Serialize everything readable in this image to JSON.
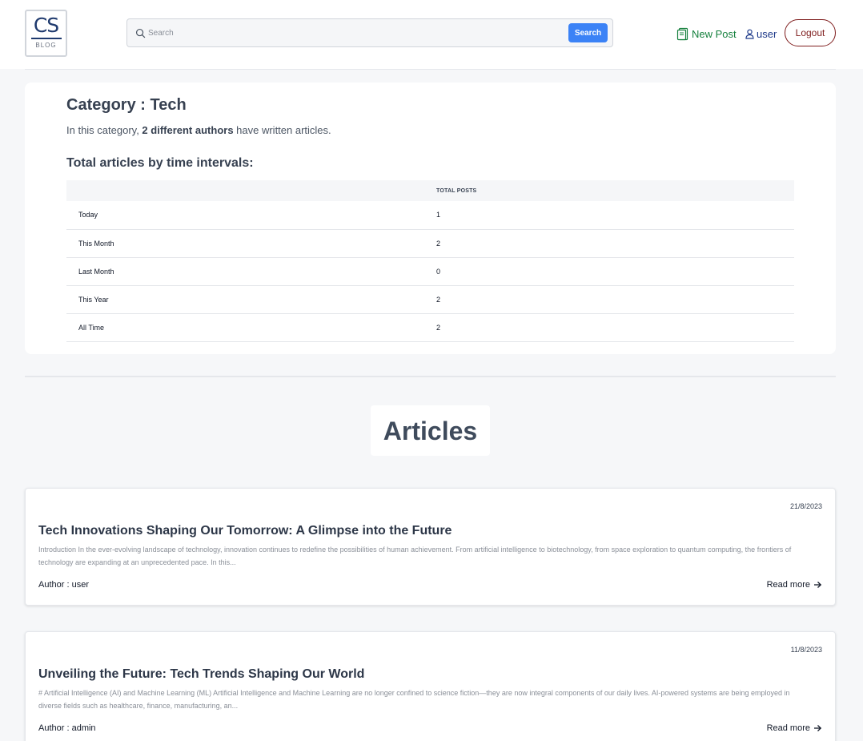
{
  "header": {
    "logo_text": "CS",
    "logo_subtext": "BLOG",
    "search_placeholder": "Search",
    "search_button": "Search",
    "new_post": "New Post",
    "user": "user",
    "logout": "Logout"
  },
  "category": {
    "title": "Category : Tech",
    "desc_prefix": "In this category, ",
    "desc_bold": "2 different authors",
    "desc_suffix": " have written articles.",
    "intervals_title": "Total articles by time intervals:",
    "table_header": [
      "",
      "TOTAL POSTS"
    ],
    "rows": [
      {
        "label": "Today",
        "value": "1"
      },
      {
        "label": "This Month",
        "value": "2"
      },
      {
        "label": "Last Month",
        "value": "0"
      },
      {
        "label": "This Year",
        "value": "2"
      },
      {
        "label": "All Time",
        "value": "2"
      }
    ]
  },
  "articles_heading": "Articles",
  "articles": [
    {
      "date": "21/8/2023",
      "title": "Tech Innovations Shaping Our Tomorrow: A Glimpse into the Future",
      "excerpt": "Introduction In the ever-evolving landscape of technology, innovation continues to redefine the possibilities of human achievement. From artificial intelligence to biotechnology, from space exploration to quantum computing, the frontiers of technology are expanding at an unprecedented pace. In this...",
      "author": "Author : user",
      "read_more": "Read more"
    },
    {
      "date": "11/8/2023",
      "title": "Unveiling the Future: Tech Trends Shaping Our World",
      "excerpt": "# Artificial Intelligence (AI) and Machine Learning (ML) Artificial Intelligence and Machine Learning are no longer confined to science fiction—they are now integral components of our daily lives. AI-powered systems are being employed in diverse fields such as healthcare, finance, manufacturing, an...",
      "author": "Author : admin",
      "read_more": "Read more"
    }
  ],
  "colors": {
    "accent": "#3b82f6",
    "new_post": "#15803d",
    "user_link": "#1e3a8a",
    "logout": "#7f1d1d"
  },
  "icons": {
    "search": "search-icon",
    "new_post": "document-icon",
    "user": "user-icon",
    "read_more": "arrow-right-icon"
  }
}
